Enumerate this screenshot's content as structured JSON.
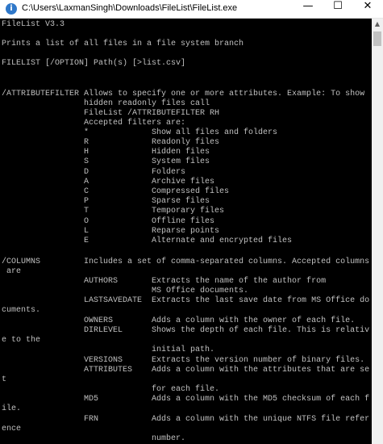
{
  "window": {
    "title": "C:\\Users\\LaxmanSingh\\Downloads\\FileList\\FileList.exe",
    "app_icon": "i",
    "minimize_glyph": "—",
    "maximize_glyph": "☐",
    "close_glyph": "✕"
  },
  "scrollbar": {
    "up_glyph": "▲"
  },
  "console": {
    "lines": [
      "FileList V3.3",
      "",
      "Prints a list of all files in a file system branch",
      "",
      "FILELIST [/OPTION] Path(s) [>list.csv]",
      "",
      "",
      "/ATTRIBUTEFILTER Allows to specify one or more attributes. Example: To show",
      "                 hidden readonly files call",
      "                 FileList /ATTRIBUTEFILTER RH",
      "                 Accepted filters are:",
      "                 *             Show all files and folders",
      "                 R             Readonly files",
      "                 H             Hidden files",
      "                 S             System files",
      "                 D             Folders",
      "                 A             Archive files",
      "                 C             Compressed files",
      "                 P             Sparse files",
      "                 T             Temporary files",
      "                 O             Offline files",
      "                 L             Reparse points",
      "                 E             Alternate and encrypted files",
      "",
      "/COLUMNS         Includes a set of comma-separated columns. Accepted columns",
      " are",
      "                 AUTHORS       Extracts the name of the author from",
      "                               MS Office documents.",
      "                 LASTSAVEDATE  Extracts the last save date from MS Office do",
      "cuments.",
      "                 OWNERS        Adds a column with the owner of each file.",
      "                 DIRLEVEL      Shows the depth of each file. This is relativ",
      "e to the",
      "                               initial path.",
      "                 VERSIONS      Extracts the version number of binary files.",
      "                 ATTRIBUTES    Adds a column with the attributes that are se",
      "t",
      "                               for each file.",
      "                 MD5           Adds a column with the MD5 checksum of each f",
      "ile.",
      "                 FRN           Adds a column with the unique NTFS file refer",
      "ence",
      "                               number."
    ]
  }
}
